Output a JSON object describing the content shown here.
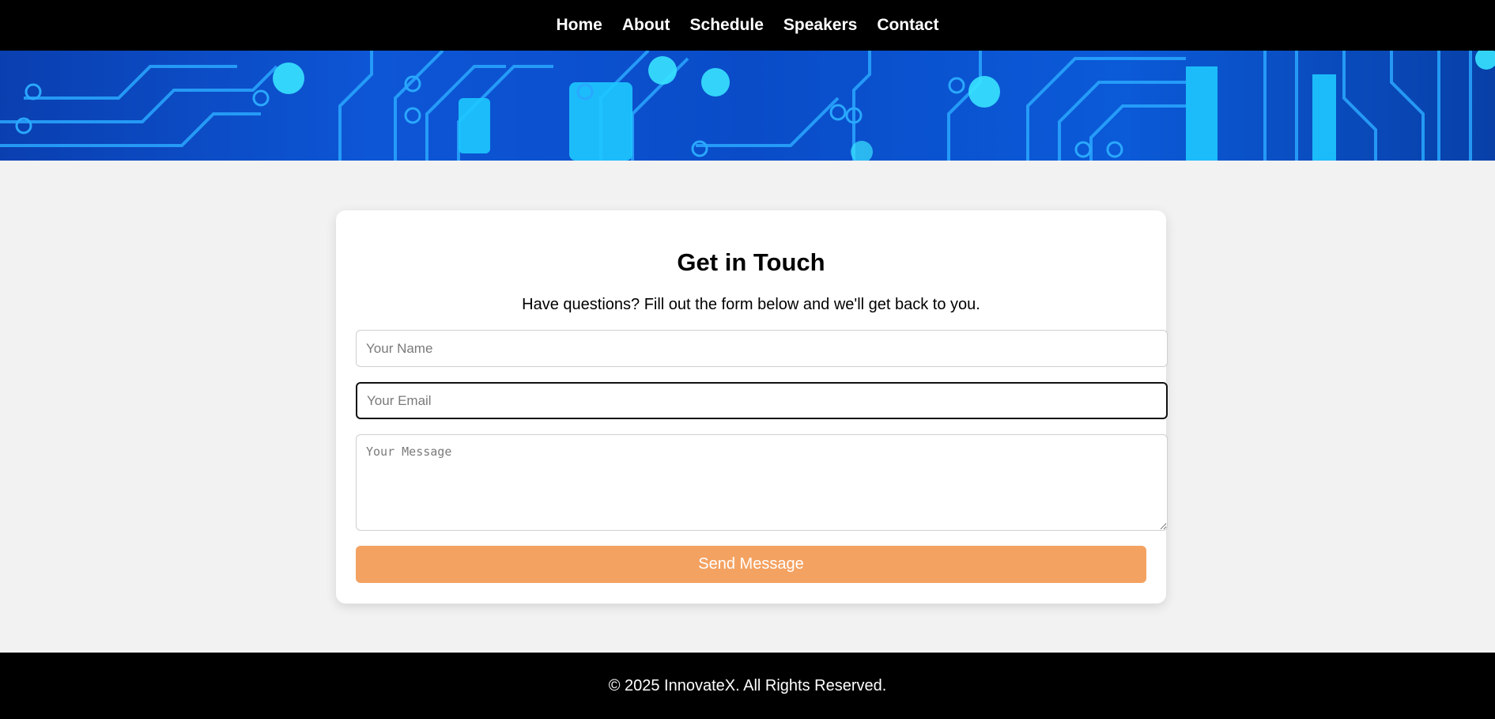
{
  "nav": {
    "items": [
      {
        "label": "Home"
      },
      {
        "label": "About"
      },
      {
        "label": "Schedule"
      },
      {
        "label": "Speakers"
      },
      {
        "label": "Contact"
      }
    ]
  },
  "banner": {
    "icon": "circuit-board-banner"
  },
  "contact": {
    "title": "Get in Touch",
    "subtitle": "Have questions? Fill out the form below and we'll get back to you.",
    "name_placeholder": "Your Name",
    "email_placeholder": "Your Email",
    "message_placeholder": "Your Message",
    "send_label": "Send Message"
  },
  "footer": {
    "text": "© 2025 InnovateX. All Rights Reserved."
  },
  "colors": {
    "nav_bg": "#000000",
    "page_bg": "#f2f2f2",
    "button": "#f4a261",
    "banner_blue": "#0d56d6",
    "circuit_cyan": "#1ec8ff"
  }
}
